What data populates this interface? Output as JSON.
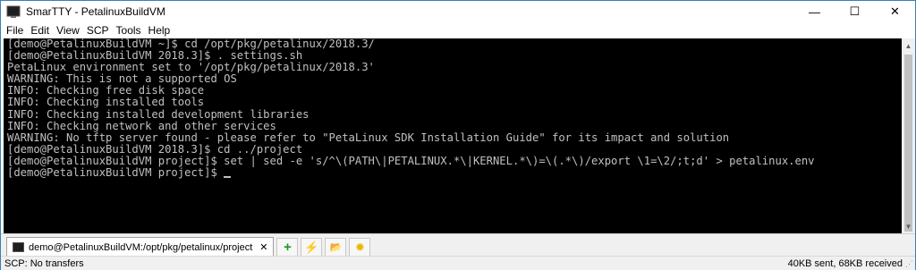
{
  "window": {
    "title": "SmarTTY - PetalinuxBuildVM",
    "controls": {
      "minimize": "—",
      "maximize": "☐",
      "close": "✕"
    }
  },
  "menu": {
    "file": "File",
    "edit": "Edit",
    "view": "View",
    "scp": "SCP",
    "tools": "Tools",
    "help": "Help"
  },
  "terminal": {
    "lines": [
      "[demo@PetalinuxBuildVM ~]$ cd /opt/pkg/petalinux/2018.3/",
      "[demo@PetalinuxBuildVM 2018.3]$ . settings.sh",
      "PetaLinux environment set to '/opt/pkg/petalinux/2018.3'",
      "WARNING: This is not a supported OS",
      "INFO: Checking free disk space",
      "INFO: Checking installed tools",
      "INFO: Checking installed development libraries",
      "INFO: Checking network and other services",
      "WARNING: No tftp server found - please refer to \"PetaLinux SDK Installation Guide\" for its impact and solution",
      "[demo@PetalinuxBuildVM 2018.3]$ cd ../project",
      "[demo@PetalinuxBuildVM project]$ set | sed -e 's/^\\(PATH\\|PETALINUX.*\\|KERNEL.*\\)=\\(.*\\)/export \\1=\\2/;t;d' > petalinux.env",
      "[demo@PetalinuxBuildVM project]$ "
    ]
  },
  "tab": {
    "label": "demo@PetalinuxBuildVM:/opt/pkg/petalinux/project",
    "close": "✕"
  },
  "toolbar": {
    "new_icon": "+",
    "run_icon": "⚡",
    "folder_icon": "📂",
    "settings_icon": "✹"
  },
  "status": {
    "left": "SCP: No transfers",
    "right": "40KB sent, 68KB received"
  }
}
